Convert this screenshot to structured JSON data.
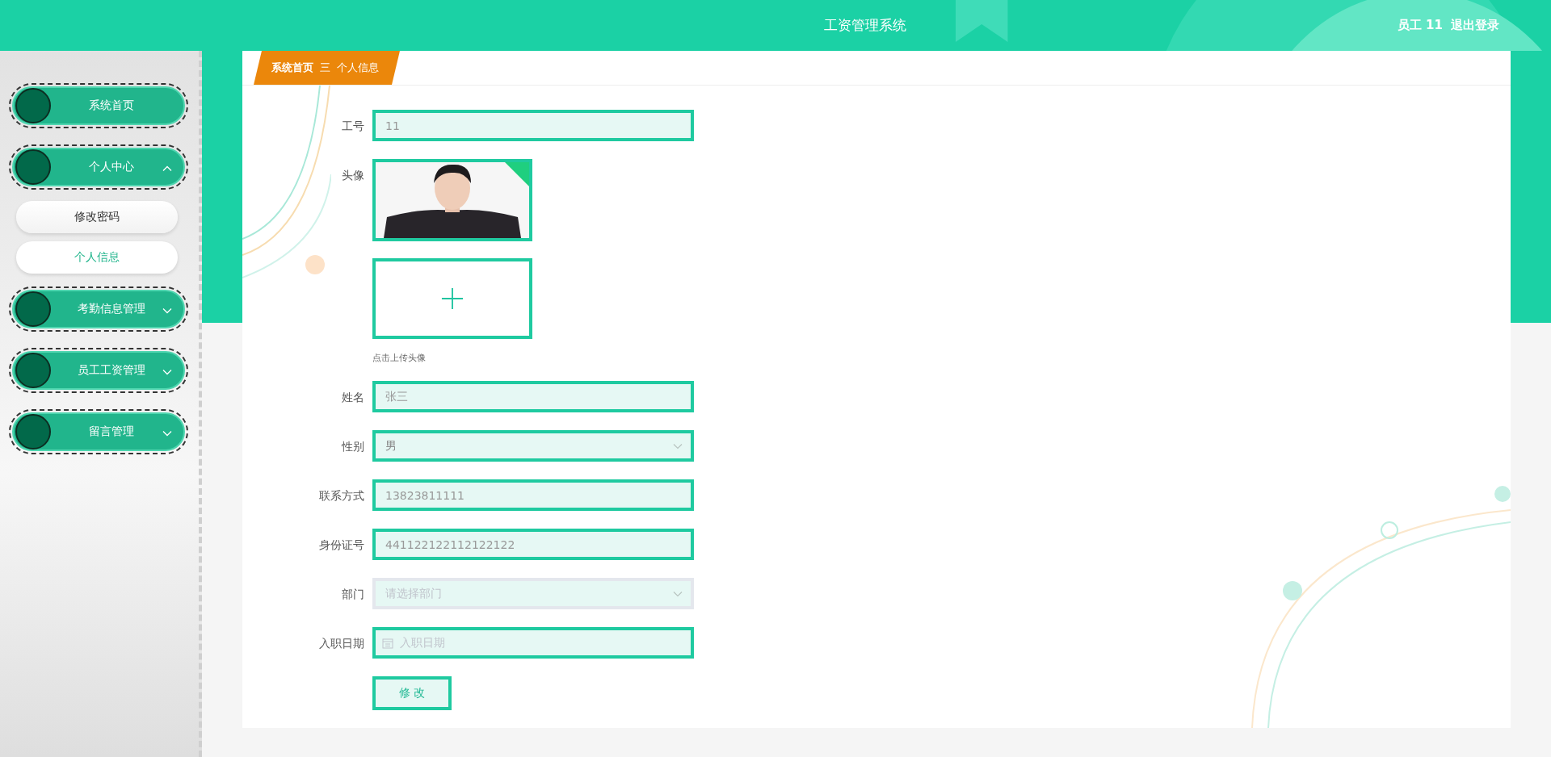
{
  "header": {
    "title": "工资管理系统",
    "user_label": "员工 11",
    "logout": "退出登录"
  },
  "sidebar": {
    "items": [
      {
        "label": "系统首页"
      },
      {
        "label": "个人中心",
        "expanded": true,
        "children": [
          {
            "label": "修改密码",
            "selected": false
          },
          {
            "label": "个人信息",
            "selected": true
          }
        ]
      },
      {
        "label": "考勤信息管理",
        "expanded": false
      },
      {
        "label": "员工工资管理",
        "expanded": false
      },
      {
        "label": "留言管理",
        "expanded": false
      }
    ]
  },
  "breadcrumb": {
    "items": [
      "系统首页",
      "个人信息"
    ],
    "separator": "三"
  },
  "form": {
    "fields": [
      {
        "kind": "text",
        "label": "工号",
        "value": "11",
        "disabled": false
      },
      {
        "label": "头像"
      },
      {
        "kind": "upload",
        "hint": "点击上传头像"
      },
      {
        "kind": "text",
        "label": "姓名",
        "value": "张三",
        "disabled": false
      },
      {
        "kind": "select",
        "label": "性别",
        "value": "男",
        "disabled": false
      },
      {
        "kind": "text",
        "label": "联系方式",
        "value": "13823811111",
        "disabled": false
      },
      {
        "kind": "text",
        "label": "身份证号",
        "value": "441122122112122122",
        "disabled": false
      },
      {
        "kind": "select",
        "label": "部门",
        "placeholder": "请选择部门",
        "disabled": true
      },
      {
        "kind": "date",
        "label": "入职日期",
        "placeholder": "入职日期",
        "disabled": false
      }
    ],
    "submit": "修 改"
  }
}
